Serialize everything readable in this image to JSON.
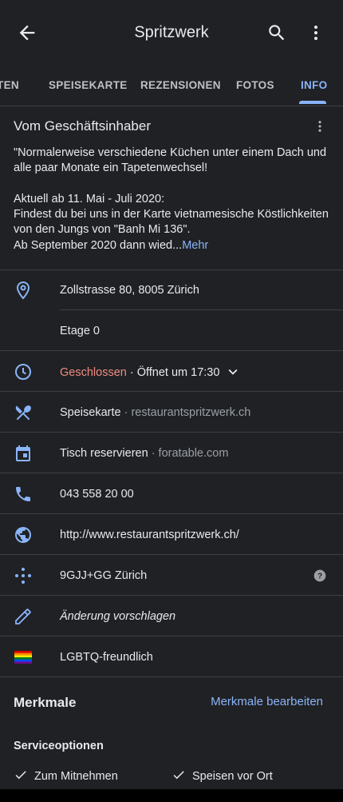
{
  "appbar": {
    "title": "Spritzwerk"
  },
  "tabs": [
    {
      "label": "ITEN"
    },
    {
      "label": "SPEISEKARTE"
    },
    {
      "label": "REZENSIONEN"
    },
    {
      "label": "FOTOS"
    },
    {
      "label": "INFO",
      "active": true
    }
  ],
  "owner": {
    "title": "Vom Geschäftsinhaber",
    "line1": "\"Normalerweise verschiedene Küchen unter einem Dach und alle paar Monate ein Tapetenwechsel!",
    "line2": "Aktuell ab 11. Mai - Juli 2020:",
    "line3": "Findest du bei uns in der Karte vietnamesische Köstlichkeiten von den Jungs von \"Banh Mi 136\".",
    "line4": "Ab September 2020 dann wied...",
    "more_link": "Mehr"
  },
  "info": {
    "address": "Zollstrasse 80, 8005 Zürich",
    "floor": "Etage 0",
    "hours_status": "Geschlossen",
    "hours_next": " · Öffnet um 17:30",
    "menu_label": "Speisekarte",
    "menu_site": " · restaurantspritzwerk.ch",
    "reserve_label": "Tisch reservieren",
    "reserve_site": " · foratable.com",
    "phone": "043 558 20 00",
    "website": "http://www.restaurantspritzwerk.ch/",
    "pluscode": "9GJJ+GG Zürich",
    "suggest": "Änderung vorschlagen",
    "lgbtq": "LGBTQ-freundlich"
  },
  "features": {
    "title": "Merkmale",
    "edit": "Merkmale bearbeiten",
    "service_title": "Serviceoptionen",
    "options": [
      "Zum Mitnehmen",
      "Speisen vor Ort"
    ]
  },
  "colors": {
    "accent": "#8ab4f8",
    "closed": "#f28b82",
    "background": "#202124"
  }
}
